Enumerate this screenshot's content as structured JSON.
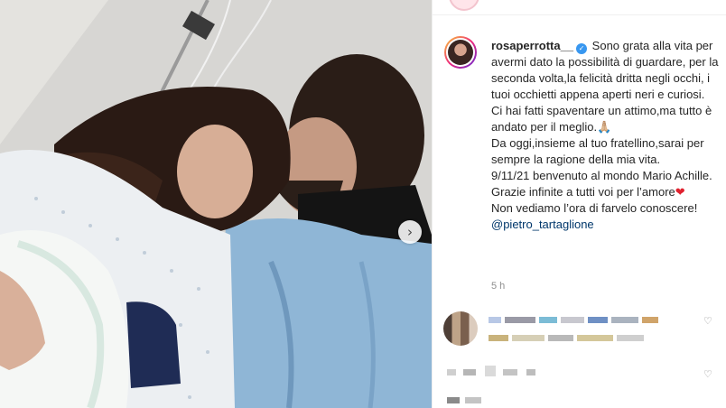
{
  "post": {
    "username": "rosaperrotta__",
    "caption_lines": [
      "Sono grata alla vita per avermi dato la possibilità di guardare, per la seconda volta,la felicità dritta negli occhi, i tuoi occhietti appena aperti neri e curiosi.",
      "Ci hai fatti spaventare un attimo,ma tutto è andato per il meglio.",
      "Da oggi,insieme al tuo fratellino,sarai per sempre la ragione della mia vita.",
      "9/11/21 benvenuto al mondo Mario Achille.",
      "Grazie infinite a tutti voi per l’amore",
      "Non vediamo l’ora di farvelo conoscere!"
    ],
    "mention": "@pietro_tartaglione",
    "time": "5 h",
    "emoji_pray": "🙏🏼",
    "emoji_heart": "❤",
    "next_glyph": "›",
    "verified_glyph": "✓",
    "heart_glyph": "♡"
  },
  "colors": {
    "text": "#262626",
    "muted": "#8e8e8e",
    "mention": "#00376b",
    "verified": "#3897f0",
    "heart": "#e0212e"
  }
}
